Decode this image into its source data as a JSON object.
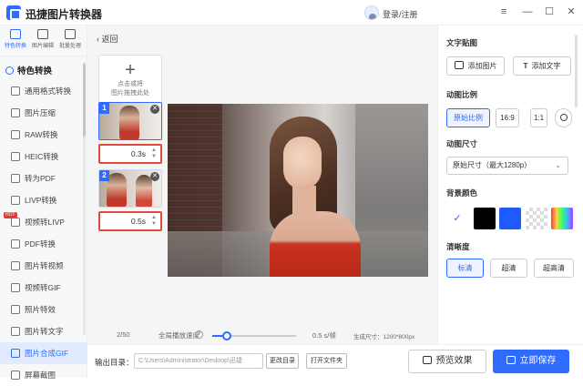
{
  "app": {
    "title": "迅捷图片转换器",
    "login": "登录/注册"
  },
  "window_buttons": [
    "≡",
    "—",
    "☐",
    "✕"
  ],
  "rail_tabs": [
    {
      "label": "特色转换",
      "icon": "convert-icon",
      "active": true
    },
    {
      "label": "图片编辑",
      "icon": "image-edit-icon",
      "active": false
    },
    {
      "label": "批量处理",
      "icon": "batch-icon",
      "active": false
    }
  ],
  "sidebar": {
    "section": "特色转换",
    "items": [
      {
        "label": "通用格式转换",
        "icon": "format-icon"
      },
      {
        "label": "图片压缩",
        "icon": "compress-icon"
      },
      {
        "label": "RAW转换",
        "icon": "raw-icon"
      },
      {
        "label": "HEIC转换",
        "icon": "heic-icon"
      },
      {
        "label": "转为PDF",
        "icon": "pdf-icon"
      },
      {
        "label": "LIVP转换",
        "icon": "livp-icon"
      },
      {
        "label": "视频转LIVP",
        "icon": "video-icon",
        "badge": "HOT"
      },
      {
        "label": "PDF转换",
        "icon": "pdf-convert-icon"
      },
      {
        "label": "图片转视频",
        "icon": "image-video-icon"
      },
      {
        "label": "视频转GIF",
        "icon": "video-gif-icon"
      },
      {
        "label": "照片特效",
        "icon": "effect-icon"
      },
      {
        "label": "图片转文字",
        "icon": "ocr-icon"
      },
      {
        "label": "图片合成GIF",
        "icon": "gif-icon",
        "active": true
      },
      {
        "label": "屏幕截图",
        "icon": "screenshot-icon"
      }
    ]
  },
  "main": {
    "back": "返回",
    "add_box": {
      "line1": "点击或将",
      "line2": "图片拖拽此处"
    },
    "frames": [
      {
        "number": "1",
        "duration": "0.3s"
      },
      {
        "number": "2",
        "duration": "0.5s"
      }
    ],
    "status": {
      "count": "2/50",
      "speed_label": "全局播放速度",
      "speed_value": "0.5 s/帧",
      "gen_size": "生成尺寸：1200*800px"
    }
  },
  "bottom": {
    "output_label": "输出目录：",
    "output_path": "C:\\Users\\Administrator\\Desktop\\迅捷",
    "change_dir": "更改目录",
    "open_folder": "打开文件夹",
    "preview": "预览效果",
    "save": "立即保存"
  },
  "right_panel": {
    "sticker_title": "文字贴图",
    "add_image": "添加图片",
    "add_text": "添加文字",
    "ratio_title": "动图比例",
    "ratios": [
      "原始比例",
      "16:9",
      "1:1"
    ],
    "size_title": "动图尺寸",
    "size_value": "原始尺寸（最大1280p）",
    "bg_title": "背景颜色",
    "bg_colors": [
      "#ffffff",
      "#000000",
      "#1e5bff"
    ],
    "clarity_title": "清晰度",
    "clarity": [
      "标清",
      "超清",
      "超高清"
    ]
  }
}
